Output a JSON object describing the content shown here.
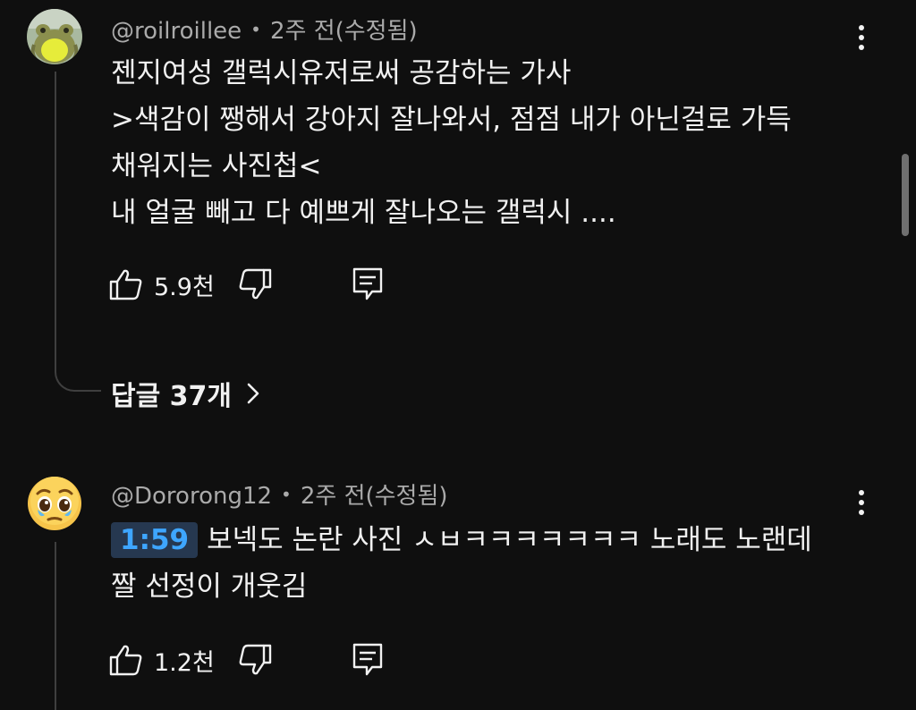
{
  "comments": [
    {
      "author": "@roilroillee",
      "time": "2주 전(수정됨)",
      "text_lines": [
        "젠지여성 갤럭시유저로써 공감하는 가사",
        ">색감이 쨍해서 강아지 잘나와서, 점점 내가 아닌걸로 가득",
        "채워지는 사진첩<",
        "내 얼굴 빼고 다 예쁘게 잘나오는 갤럭시 ...."
      ],
      "likes": "5.9천",
      "replies_label": "답글 37개",
      "avatar_icon": "frog-avatar-icon"
    },
    {
      "author": "@Dororong12",
      "time": "2주 전(수정됨)",
      "timestamp_link": "1:59",
      "text_lines": [
        "보넥도 논란 사진 ㅅㅂㅋㅋㅋㅋㅋㅋㅋ 노래도 노랜데",
        "짤 선정이 개웃김"
      ],
      "likes": "1.2천",
      "avatar_icon": "teary-emoji-avatar-icon"
    }
  ],
  "separator": "•",
  "colors": {
    "background": "#0f0f0f",
    "text": "#f1f1f1",
    "secondary_text": "#aaaaaa",
    "timestamp_link": "#3ea6ff",
    "timestamp_bg": "#263850"
  }
}
